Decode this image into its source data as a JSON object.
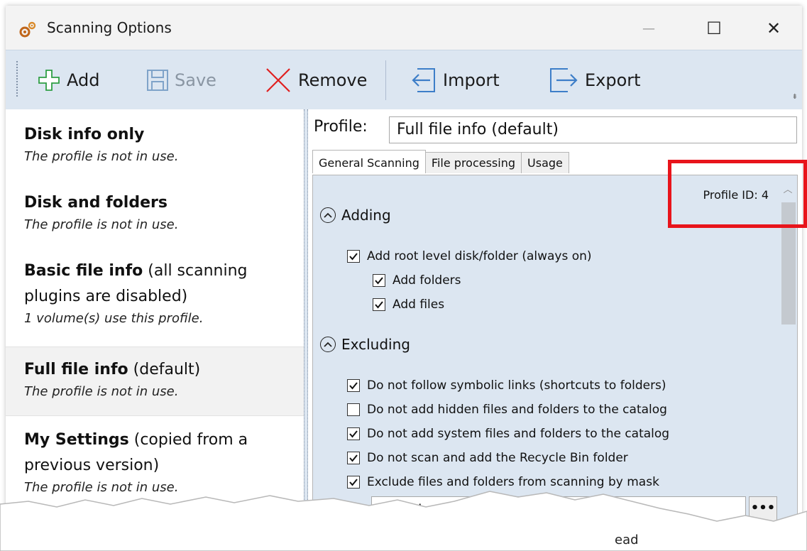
{
  "window": {
    "title": "Scanning Options",
    "controls": {
      "minimize": "—",
      "maximize": "☐",
      "close": "✕"
    }
  },
  "toolbar": {
    "add_label": "Add",
    "save_label": "Save",
    "remove_label": "Remove",
    "import_label": "Import",
    "export_label": "Export"
  },
  "profiles": [
    {
      "name": "Disk info only",
      "suffix": "",
      "status": "The profile is not in use."
    },
    {
      "name": "Disk and folders",
      "suffix": "",
      "status": "The profile is not in use."
    },
    {
      "name": "Basic file info",
      "suffix": " (all scanning plugins are disabled)",
      "status": "1 volume(s) use this profile."
    },
    {
      "name": "Full file info",
      "suffix": " (default)",
      "status": "The profile is not in use.",
      "selected": true
    },
    {
      "name": "My Settings",
      "suffix": " (copied from a previous version)",
      "status": "The profile is not in use."
    }
  ],
  "profile": {
    "label": "Profile:",
    "value": "Full file info (default)",
    "id_label": "Profile ID: 4"
  },
  "tabs": [
    {
      "label": "General Scanning",
      "active": true
    },
    {
      "label": "File processing",
      "active": false
    },
    {
      "label": "Usage",
      "active": false
    }
  ],
  "sections": {
    "adding": {
      "title": "Adding",
      "options": [
        {
          "label": "Add root level disk/folder (always on)",
          "checked": true
        },
        {
          "label": "Add folders",
          "checked": true
        },
        {
          "label": "Add files",
          "checked": true
        }
      ]
    },
    "excluding": {
      "title": "Excluding",
      "options": [
        {
          "label": "Do not follow symbolic links (shortcuts to folders)",
          "checked": true
        },
        {
          "label": "Do not add hidden files and folders to the catalog",
          "checked": false
        },
        {
          "label": "Do not add system files and folders to the catalog",
          "checked": true
        },
        {
          "label": "Do not scan and add the Recycle Bin folder",
          "checked": true
        },
        {
          "label": "Exclude files and folders from scanning by mask",
          "checked": true
        }
      ],
      "mask_value": "Thumbs.db;*.tmp;*.bak",
      "mask_button": "•••"
    }
  },
  "fragment_text": "ead",
  "colors": {
    "accent": "#dce6f1",
    "highlight": "#e8141b",
    "add_green": "#2f9e44",
    "remove_red": "#e02020",
    "io_blue": "#3d7ec8"
  }
}
